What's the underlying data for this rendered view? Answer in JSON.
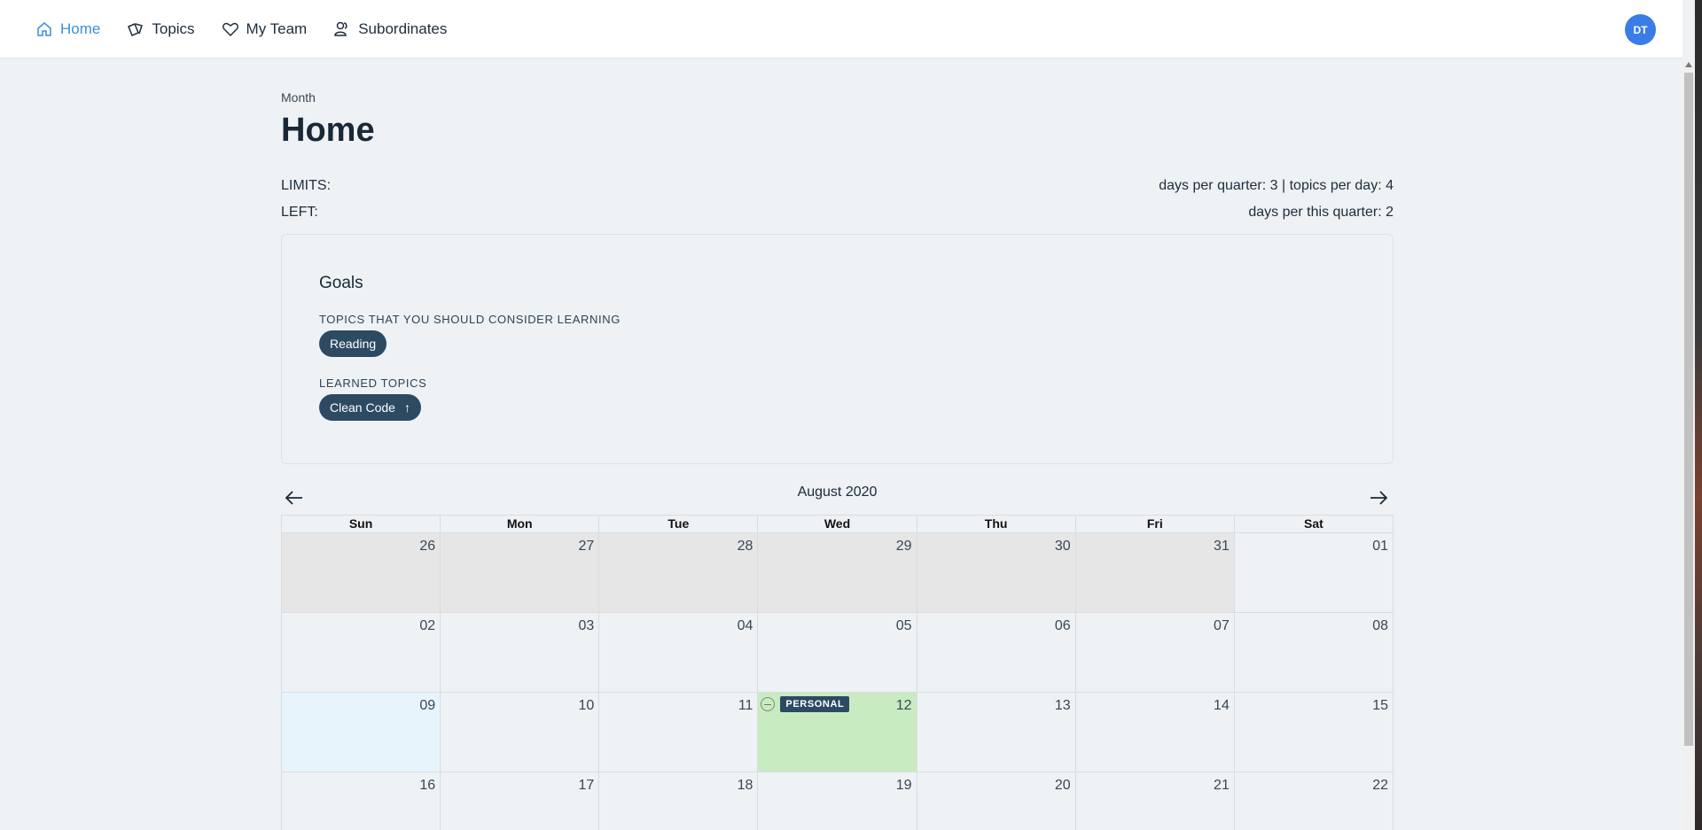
{
  "nav": {
    "items": [
      {
        "label": "Home",
        "icon": "home-icon",
        "active": true
      },
      {
        "label": "Topics",
        "icon": "cards-icon",
        "active": false
      },
      {
        "label": "My Team",
        "icon": "heart-icon",
        "active": false
      },
      {
        "label": "Subordinates",
        "icon": "users-icon",
        "active": false
      }
    ],
    "avatar": "DT"
  },
  "page": {
    "breadcrumb": "Month",
    "title": "Home",
    "limits_label": "LIMITS:",
    "limits_value": "days per quarter: 3 | topics per day: 4",
    "left_label": "LEFT:",
    "left_value": "days per this quarter: 2"
  },
  "goals": {
    "title": "Goals",
    "consider_label": "TOPICS THAT YOU SHOULD CONSIDER LEARNING",
    "consider_topics": [
      "Reading"
    ],
    "learned_label": "LEARNED TOPICS",
    "learned_topics": [
      "Clean Code"
    ],
    "learned_icon": "arrow-up-icon"
  },
  "calendar": {
    "month": "August 2020",
    "weekdays": [
      "Sun",
      "Mon",
      "Tue",
      "Wed",
      "Thu",
      "Fri",
      "Sat"
    ],
    "weeks": [
      [
        "26",
        "27",
        "28",
        "29",
        "30",
        "31",
        "01"
      ],
      [
        "02",
        "03",
        "04",
        "05",
        "06",
        "07",
        "08"
      ],
      [
        "09",
        "10",
        "11",
        "12",
        "13",
        "14",
        "15"
      ],
      [
        "16",
        "17",
        "18",
        "19",
        "20",
        "21",
        "22"
      ]
    ],
    "event_tag": "PERSONAL",
    "colors": {
      "off": "#e6e6e6",
      "today": "#e8f4fc",
      "event": "#c9ebc1",
      "accent": "#3b8fd6",
      "pill": "#2d4a63"
    }
  }
}
